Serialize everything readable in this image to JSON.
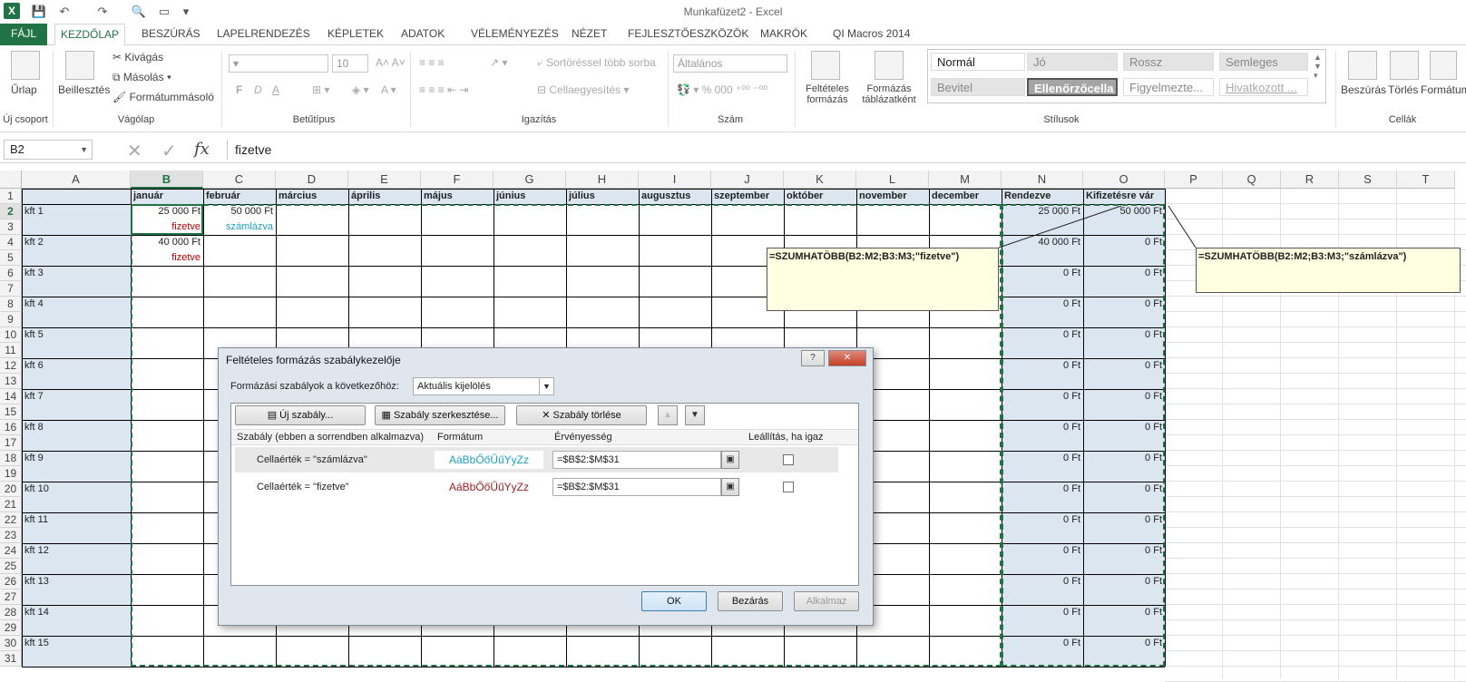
{
  "window": {
    "title": "Munkafüzet2 - Excel"
  },
  "tabs": [
    {
      "label": "FÁJL"
    },
    {
      "label": "KEZDŐLAP"
    },
    {
      "label": "BESZÚRÁS"
    },
    {
      "label": "LAPELRENDEZÉS"
    },
    {
      "label": "KÉPLETEK"
    },
    {
      "label": "ADATOK"
    },
    {
      "label": "VÉLEMÉNYEZÉS"
    },
    {
      "label": "NÉZET"
    },
    {
      "label": "FEJLESZTŐESZKÖZÖK"
    },
    {
      "label": "MAKRÓK"
    },
    {
      "label": "QI Macros 2014"
    }
  ],
  "ribbon": {
    "urlap": "Űrlap",
    "uj_csoport": "Új csoport",
    "beillesztes": "Beillesztés",
    "kivagas": "Kivágás",
    "masolas": "Másolás",
    "formatummasolo": "Formátummásoló",
    "vagolap": "Vágólap",
    "font_size": "10",
    "betutipus": "Betűtípus",
    "bold": "F",
    "italic": "D",
    "underline": "A",
    "sortores": "Sortöréssel több sorba",
    "cellaegyesites": "Cellaegyesítés",
    "igazitas": "Igazítás",
    "number_format": "Általános",
    "szam": "Szám",
    "feltételes": "Feltételes formázás",
    "formazas_tabla": "Formázás táblázatként",
    "stilusok": "Stílusok",
    "styles": [
      "Normál",
      "Jó",
      "Rossz",
      "Semleges",
      "Bevitel",
      "Ellenőrzőcella",
      "Figyelmezte...",
      "Hivatkozott ..."
    ],
    "beszuras": "Beszúrás",
    "torles": "Törlés",
    "formatum": "Formátum",
    "cellak": "Cellák"
  },
  "formula_bar": {
    "name_box": "B2",
    "fx": "fx",
    "content": "fizetve"
  },
  "columns": [
    "A",
    "B",
    "C",
    "D",
    "E",
    "F",
    "G",
    "H",
    "I",
    "J",
    "K",
    "L",
    "M",
    "N",
    "O",
    "P",
    "Q",
    "R",
    "S",
    "T"
  ],
  "header_row": [
    "",
    "január",
    "február",
    "március",
    "április",
    "május",
    "június",
    "július",
    "augusztus",
    "szeptember",
    "október",
    "november",
    "december",
    "Rendezve",
    "Kifizetésre vár"
  ],
  "companies": [
    "kft 1",
    "kft 2",
    "kft 3",
    "kft 4",
    "kft 5",
    "kft 6",
    "kft 7",
    "kft 8",
    "kft 9",
    "kft 10",
    "kft 11",
    "kft 12",
    "kft 13",
    "kft 14",
    "kft 15"
  ],
  "rendezve": [
    "25 000 Ft",
    "40 000 Ft",
    "0 Ft",
    "0 Ft",
    "0 Ft",
    "0 Ft",
    "0 Ft",
    "0 Ft",
    "0 Ft",
    "0 Ft",
    "0 Ft",
    "0 Ft",
    "0 Ft",
    "0 Ft",
    "0 Ft"
  ],
  "kifizetesre": [
    "50 000 Ft",
    "0 Ft",
    "0 Ft",
    "0 Ft",
    "0 Ft",
    "0 Ft",
    "0 Ft",
    "0 Ft",
    "0 Ft",
    "0 Ft",
    "0 Ft",
    "0 Ft",
    "0 Ft",
    "0 Ft",
    "0 Ft"
  ],
  "cells": {
    "b2": "25 000 Ft",
    "b3": "fizetve",
    "c2": "50 000 Ft",
    "c3": "számlázva",
    "b4": "40 000 Ft",
    "b5": "fizetve"
  },
  "notes": {
    "n_formula": "=SZUMHATÖBB(B2:M2;B3:M3;\"fizetve\")",
    "o_formula": "=SZUMHATÖBB(B2:M2;B3:M3;\"számlázva\")"
  },
  "dialog": {
    "title": "Feltételes formázás szabálykezelője",
    "show_label": "Formázási szabályok a következőhöz:",
    "show_value": "Aktuális kijelölés",
    "new_rule": "Új szabály...",
    "edit_rule": "Szabály szerkesztése...",
    "delete_rule": "Szabály törlése",
    "col_rule": "Szabály (ebben a sorrendben alkalmazva)",
    "col_format": "Formátum",
    "col_applies": "Érvényesség",
    "col_stop": "Leállítás, ha igaz",
    "rules": [
      {
        "rule": "Cellaérték = \"számlázva\"",
        "preview": "AáBbŐőŰűYyZz",
        "applies": "=$B$2:$M$31",
        "color": "#1fa0c8"
      },
      {
        "rule": "Cellaérték = \"fizetve\"",
        "preview": "AáBbŐőŰűYyZz",
        "applies": "=$B$2:$M$31",
        "color": "#9c1c1c"
      }
    ],
    "ok": "OK",
    "close": "Bezárás",
    "apply": "Alkalmaz",
    "help": "?",
    "x": "✕"
  },
  "colors": {
    "accent": "#217346",
    "band": "#dce6f1",
    "paid": "#c00000",
    "invoiced": "#1fa0c8"
  }
}
